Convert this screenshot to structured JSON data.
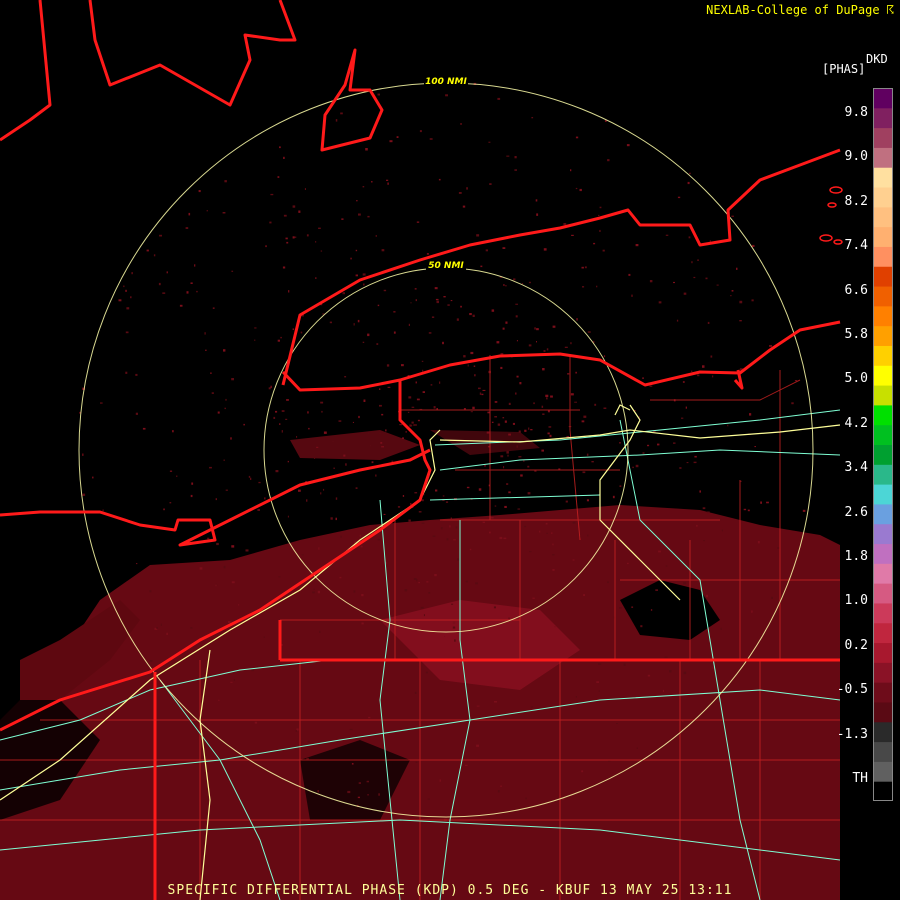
{
  "header": {
    "credit": "NEXLAB-College of DuPage ☈"
  },
  "footer": {
    "caption": "SPECIFIC DIFFERENTIAL PHASE (KDP) 0.5 DEG - KBUF 13 MAY 25 13:11"
  },
  "map": {
    "radar_site": "KBUF",
    "range_rings": [
      {
        "label": "50 NMI",
        "nmi": 50
      },
      {
        "label": "100 NMI",
        "nmi": 100
      }
    ],
    "colors": {
      "state_borders": "#ff1a1a",
      "county_lines": "#cc2222",
      "range_rings": "#ffffaa",
      "highways_interstate": "#ffff99",
      "highways_secondary": "#7fffd4",
      "precip_low": "#6b0a14",
      "precip_mid": "#8a1020"
    }
  },
  "legend": {
    "product": "DKD",
    "units": "[PHAS]",
    "labels": [
      "9.8",
      "9.0",
      "8.2",
      "7.4",
      "6.6",
      "5.8",
      "5.0",
      "4.2",
      "3.4",
      "2.6",
      "1.8",
      "1.0",
      "0.2",
      "-0.5",
      "-1.3",
      "TH"
    ],
    "colors": [
      "#000000",
      "#606060",
      "#484848",
      "#2a2a2a",
      "#5a0a14",
      "#6e0c1a",
      "#8a1226",
      "#a8182e",
      "#c0263e",
      "#cc3a5a",
      "#d65a82",
      "#e07aa8",
      "#c070c0",
      "#9a7ad0",
      "#6aa0e0",
      "#4cd6d6",
      "#2ab88a",
      "#00a030",
      "#00c020",
      "#00e000",
      "#c8e000",
      "#ffff00",
      "#ffd000",
      "#ffa000",
      "#ff8000",
      "#f06000",
      "#e04000",
      "#ff9060",
      "#ffb070",
      "#ffc080",
      "#ffd090",
      "#ffe0a0",
      "#c07080",
      "#a04060",
      "#802060",
      "#600060"
    ]
  }
}
